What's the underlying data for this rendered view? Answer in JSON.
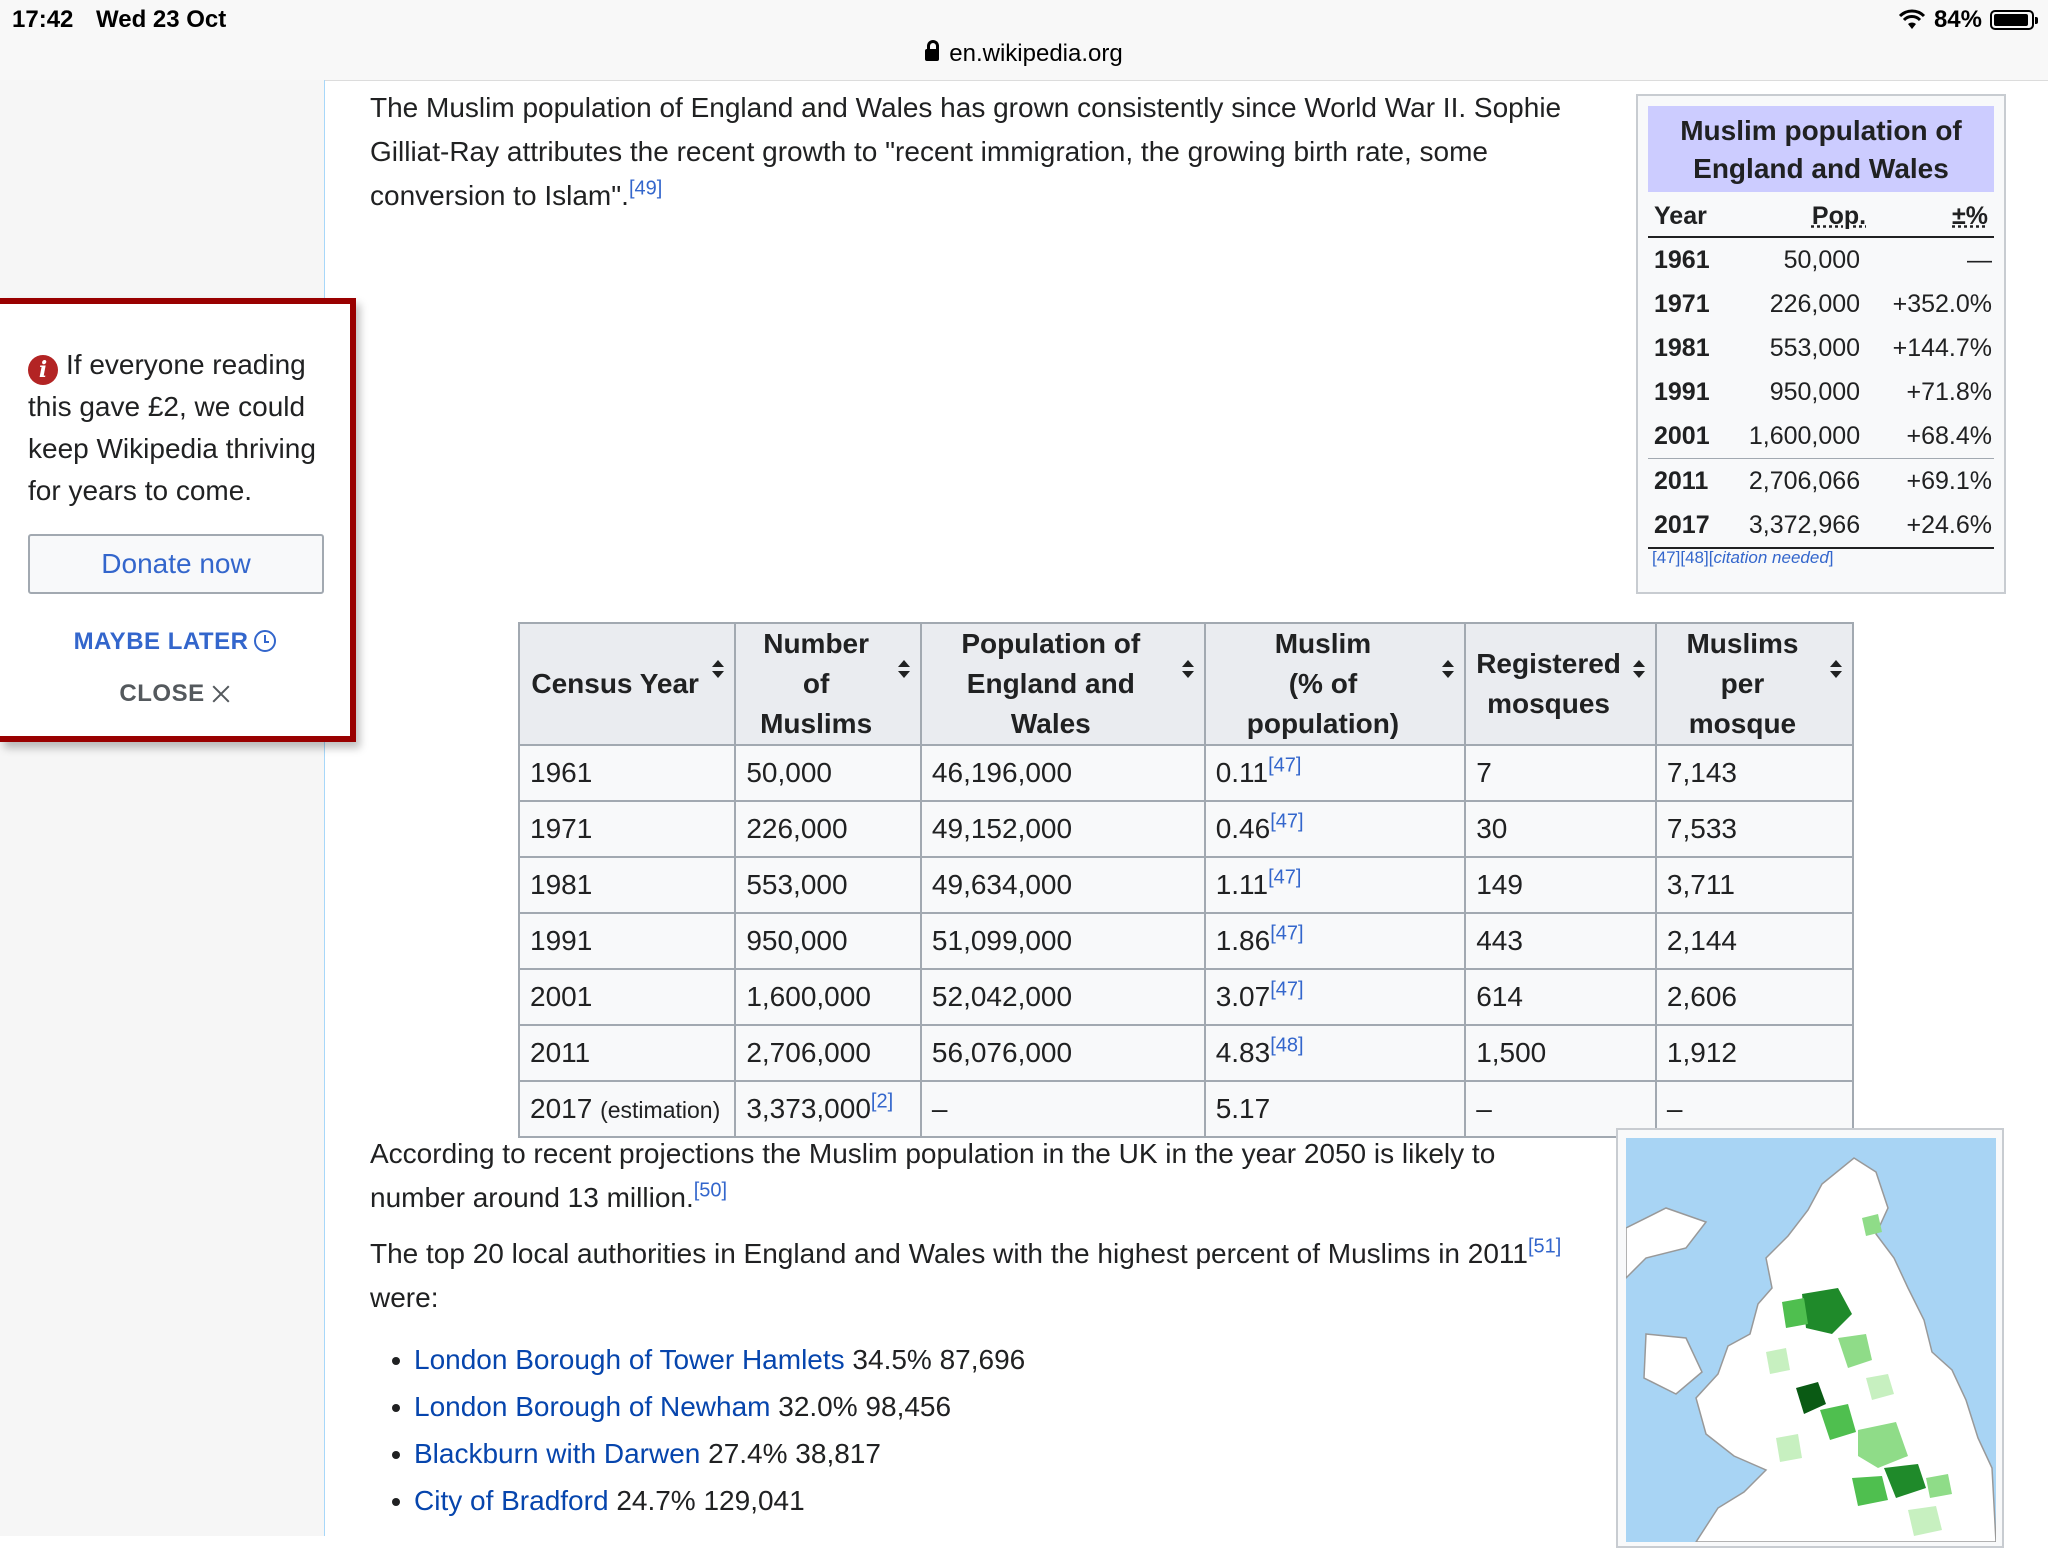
{
  "status_bar": {
    "time": "17:42",
    "date": "Wed 23 Oct",
    "url": "en.wikipedia.org",
    "battery": "84%",
    "battery_level": 0.84,
    "icons": [
      "lock-icon",
      "wifi-icon",
      "battery-icon"
    ]
  },
  "banner": {
    "message": "If everyone reading this gave £2, we could keep Wikipedia thriving for years to come.",
    "donate_label": "Donate now",
    "maybe_later_label": "MAYBE LATER",
    "close_label": "CLOSE",
    "border_color": "#990000",
    "icons": [
      "info-icon",
      "clock-icon",
      "close-icon"
    ]
  },
  "article": {
    "para1": {
      "text": "The Muslim population of England and Wales has grown consistently since World War II. Sophie Gilliat-Ray attributes the recent growth to \"recent immigration, the growing birth rate, some conversion to Islam\".",
      "ref": "[49]"
    },
    "para2": {
      "text": "According to recent projections the Muslim population in the UK in the year 2050 is likely to number around 13 million.",
      "ref": "[50]"
    },
    "para3": {
      "text": "The top 20 local authorities in England and Wales with the highest percent of Muslims in 2011",
      "ref": "[51]",
      "tail": "were:"
    },
    "list": [
      {
        "link": "London Borough of Tower Hamlets",
        "rest": "34.5% 87,696"
      },
      {
        "link": "London Borough of Newham",
        "rest": "32.0% 98,456"
      },
      {
        "link": "Blackburn with Darwen",
        "rest": "27.4% 38,817"
      },
      {
        "link": "City of Bradford",
        "rest": "24.7% 129,041"
      }
    ]
  },
  "infobox": {
    "title": "Muslim population of England and Wales",
    "headers": {
      "year": "Year",
      "pop": "Pop.",
      "change": "±%"
    },
    "rows": [
      {
        "year": "1961",
        "pop": "50,000",
        "change": "—"
      },
      {
        "year": "1971",
        "pop": "226,000",
        "change": "+352.0%"
      },
      {
        "year": "1981",
        "pop": "553,000",
        "change": "+144.7%"
      },
      {
        "year": "1991",
        "pop": "950,000",
        "change": "+71.8%"
      },
      {
        "year": "2001",
        "pop": "1,600,000",
        "change": "+68.4%"
      },
      {
        "year": "2011",
        "pop": "2,706,066",
        "change": "+69.1%"
      },
      {
        "year": "2017",
        "pop": "3,372,966",
        "change": "+24.6%"
      }
    ],
    "refs": {
      "r1": "[47]",
      "r2": "[48]",
      "r3_open": "[",
      "r3_text": "citation needed",
      "r3_close": "]"
    },
    "header_bg": "#ccccff"
  },
  "census_table": {
    "headers": [
      {
        "l1": "Census Year",
        "l2": ""
      },
      {
        "l1": "Number",
        "l2": "of Muslims"
      },
      {
        "l1": "Population of",
        "l2": "England and Wales"
      },
      {
        "l1": "Muslim",
        "l2": "(% of population)"
      },
      {
        "l1": "Registered",
        "l2": "mosques"
      },
      {
        "l1": "Muslims",
        "l2": "per mosque"
      }
    ],
    "rows": [
      {
        "year": "1961",
        "year_note": "",
        "muslims": "50,000",
        "muslims_ref": "",
        "population": "46,196,000",
        "pct": "0.11",
        "pct_ref": "[47]",
        "mosques": "7",
        "per_mosque": "7,143"
      },
      {
        "year": "1971",
        "year_note": "",
        "muslims": "226,000",
        "muslims_ref": "",
        "population": "49,152,000",
        "pct": "0.46",
        "pct_ref": "[47]",
        "mosques": "30",
        "per_mosque": "7,533"
      },
      {
        "year": "1981",
        "year_note": "",
        "muslims": "553,000",
        "muslims_ref": "",
        "population": "49,634,000",
        "pct": "1.11",
        "pct_ref": "[47]",
        "mosques": "149",
        "per_mosque": "3,711"
      },
      {
        "year": "1991",
        "year_note": "",
        "muslims": "950,000",
        "muslims_ref": "",
        "population": "51,099,000",
        "pct": "1.86",
        "pct_ref": "[47]",
        "mosques": "443",
        "per_mosque": "2,144"
      },
      {
        "year": "2001",
        "year_note": "",
        "muslims": "1,600,000",
        "muslims_ref": "",
        "population": "52,042,000",
        "pct": "3.07",
        "pct_ref": "[47]",
        "mosques": "614",
        "per_mosque": "2,606"
      },
      {
        "year": "2011",
        "year_note": "",
        "muslims": "2,706,000",
        "muslims_ref": "",
        "population": "56,076,000",
        "pct": "4.83",
        "pct_ref": "[48]",
        "mosques": "1,500",
        "per_mosque": "1,912"
      },
      {
        "year": "2017",
        "year_note": "(estimation)",
        "muslims": "3,373,000",
        "muslims_ref": "[2]",
        "population": "–",
        "pct": "5.17",
        "pct_ref": "",
        "mosques": "–",
        "per_mosque": "–"
      }
    ]
  },
  "map": {
    "sea_color": "#a8d4f4",
    "land_color": "#ffffff",
    "shade_colors": [
      "#c7f0c0",
      "#8fdc88",
      "#4fbf4f",
      "#1f8a2a",
      "#0a5a14"
    ]
  }
}
